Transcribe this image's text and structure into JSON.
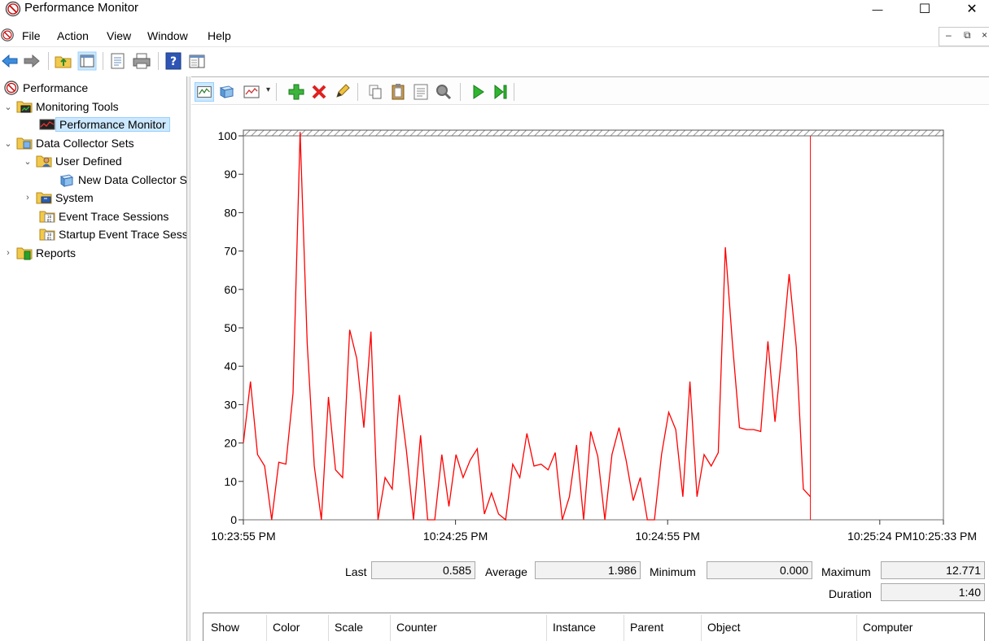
{
  "window": {
    "title": "Performance Monitor",
    "minimize_glyph": "—",
    "maximize_glyph": "☐",
    "close_glyph": "✕"
  },
  "menu": {
    "items": [
      "File",
      "Action",
      "View",
      "Window",
      "Help"
    ],
    "mdi_minimize": "–",
    "mdi_restore": "⧉",
    "mdi_close": "×"
  },
  "tree": {
    "root": "Performance",
    "monitoring_tools": "Monitoring Tools",
    "performance_monitor": "Performance Monitor",
    "data_collector_sets": "Data Collector Sets",
    "user_defined": "User Defined",
    "new_data_collector": "New Data Collector Set",
    "system": "System",
    "event_trace_sessions": "Event Trace Sessions",
    "startup_event_trace": "Startup Event Trace Sessions",
    "reports": "Reports"
  },
  "stats": {
    "last_label": "Last",
    "last_value": "0.585",
    "average_label": "Average",
    "average_value": "1.986",
    "minimum_label": "Minimum",
    "minimum_value": "0.000",
    "maximum_label": "Maximum",
    "maximum_value": "12.771",
    "duration_label": "Duration",
    "duration_value": "1:40"
  },
  "counter_table": {
    "columns": [
      "Show",
      "Color",
      "Scale",
      "Counter",
      "Instance",
      "Parent",
      "Object",
      "Computer"
    ]
  },
  "colors": {
    "series": "#ff0000",
    "selection": "#cce8ff"
  },
  "chart_data": {
    "type": "line",
    "ylim": [
      0,
      100
    ],
    "yticks": [
      0,
      10,
      20,
      30,
      40,
      50,
      60,
      70,
      80,
      90,
      100
    ],
    "xtick_labels": [
      "10:23:55 PM",
      "10:24:25 PM",
      "10:24:55 PM",
      "10:25:24 PM",
      "10:25:33 PM"
    ],
    "xlim_seconds": [
      0,
      100
    ],
    "current_position_seconds": 81,
    "series": [
      {
        "color": "#ff0000",
        "values": [
          20,
          36,
          17,
          14,
          0,
          15,
          14.5,
          33,
          101,
          46,
          14,
          0,
          32,
          13,
          11,
          49.5,
          42,
          24,
          49,
          0,
          11,
          8,
          32.5,
          18,
          0,
          22,
          0,
          0,
          17,
          3.5,
          17,
          11,
          15.5,
          18.5,
          1.5,
          7,
          1.5,
          0,
          14.5,
          11,
          22.5,
          14,
          14.5,
          13,
          17.5,
          0,
          6,
          19.5,
          0,
          23,
          16.5,
          0,
          17,
          24,
          15.5,
          5,
          11,
          0,
          0,
          17,
          28,
          23.5,
          6,
          36,
          6,
          17,
          14,
          17.5,
          71,
          46,
          24,
          23.5,
          23.5,
          23,
          46.5,
          25.5,
          44,
          64,
          45,
          8,
          6
        ]
      }
    ]
  }
}
